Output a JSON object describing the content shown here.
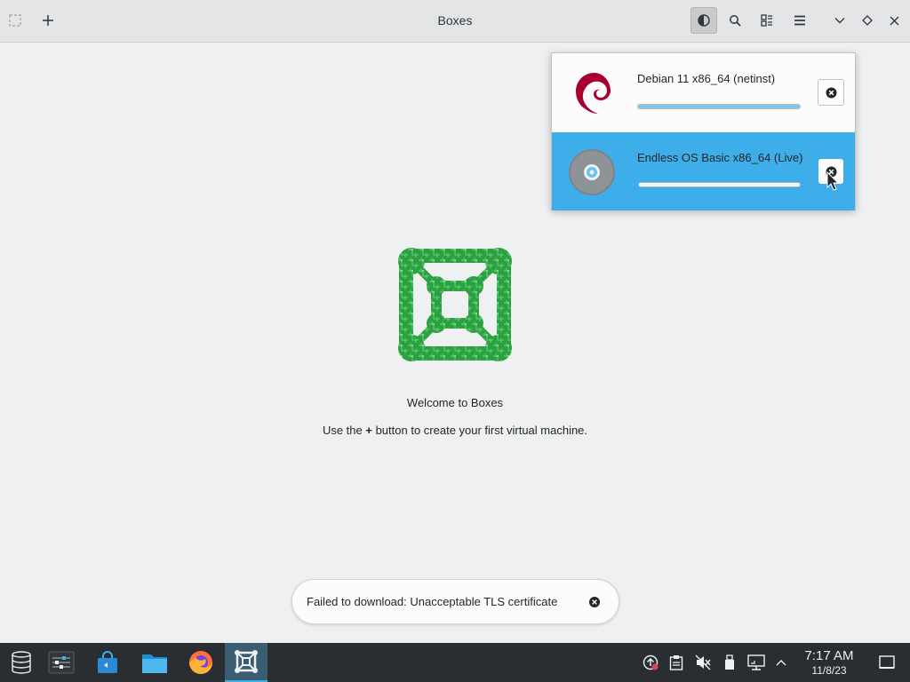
{
  "window": {
    "title": "Boxes"
  },
  "downloads": [
    {
      "name": "Debian 11 x86_64 (netinst)",
      "progress": 1.0,
      "icon": "debian-logo-icon",
      "selected": false
    },
    {
      "name": "Endless OS Basic x86_64 (Live)",
      "progress": 0.0,
      "icon": "disc-icon",
      "selected": true
    }
  ],
  "empty_state": {
    "welcome": "Welcome to Boxes",
    "hint_before": "Use the ",
    "hint_bold": "+",
    "hint_after": " button to create your first virtual machine."
  },
  "toast": {
    "message": "Failed to download: Unacceptable TLS certificate"
  },
  "taskbar": {
    "time": "7:17 AM",
    "date": "11/8/23"
  },
  "colors": {
    "accent": "#3daee9",
    "logo_green": "#2ea043",
    "taskbar": "#2a2e32"
  }
}
